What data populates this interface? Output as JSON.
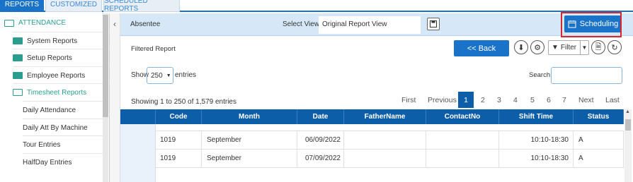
{
  "tabs": [
    {
      "label": "REPORTS"
    },
    {
      "label": "CUSTOMIZED"
    },
    {
      "label": "SCHEDULED REPORTS"
    }
  ],
  "sidebar": {
    "header": "ATTENDANCE",
    "items": [
      {
        "label": "System Reports"
      },
      {
        "label": "Setup Reports"
      },
      {
        "label": "Employee Reports"
      },
      {
        "label": "Timesheet Reports"
      },
      {
        "label": "Daily Attendance"
      },
      {
        "label": "Daily Att By Machine"
      },
      {
        "label": "Tour Entries"
      },
      {
        "label": "HalfDay Entries"
      }
    ]
  },
  "header": {
    "report_name": "Absentee",
    "select_view_label": "Select View:",
    "select_view_value": "Original Report View",
    "scheduling_label": "Scheduling"
  },
  "toolbar": {
    "filtered_label": "Filtered Report",
    "back_label": "<< Back",
    "filter_label": "Filter"
  },
  "entries": {
    "show_label": "Show",
    "value": "250",
    "suffix": "entries",
    "search_label": "Search:",
    "search_value": ""
  },
  "info": "Showing 1 to 250 of 1,579 entries",
  "pagination": {
    "first": "First",
    "previous": "Previous",
    "pages": [
      "1",
      "2",
      "3",
      "4",
      "5",
      "6",
      "7"
    ],
    "next": "Next",
    "last": "Last",
    "current": "1"
  },
  "table": {
    "columns": [
      "Code",
      "Month",
      "Date",
      "FatherName",
      "ContactNo",
      "Shift Time",
      "Status"
    ],
    "rows": [
      {
        "code": "1019",
        "month": "September",
        "date": "06/09/2022",
        "father": "",
        "contact": "",
        "shift": "10:10-18:30",
        "status": "A"
      },
      {
        "code": "1019",
        "month": "September",
        "date": "07/09/2022",
        "father": "",
        "contact": "",
        "shift": "10:10-18:30",
        "status": "A"
      }
    ]
  },
  "colors": {
    "accent": "#1a73c8",
    "header_bg": "#d6e8f7",
    "table_header": "#0d5ea8",
    "highlight": "#d9262c",
    "folder": "#2a9d8f"
  }
}
